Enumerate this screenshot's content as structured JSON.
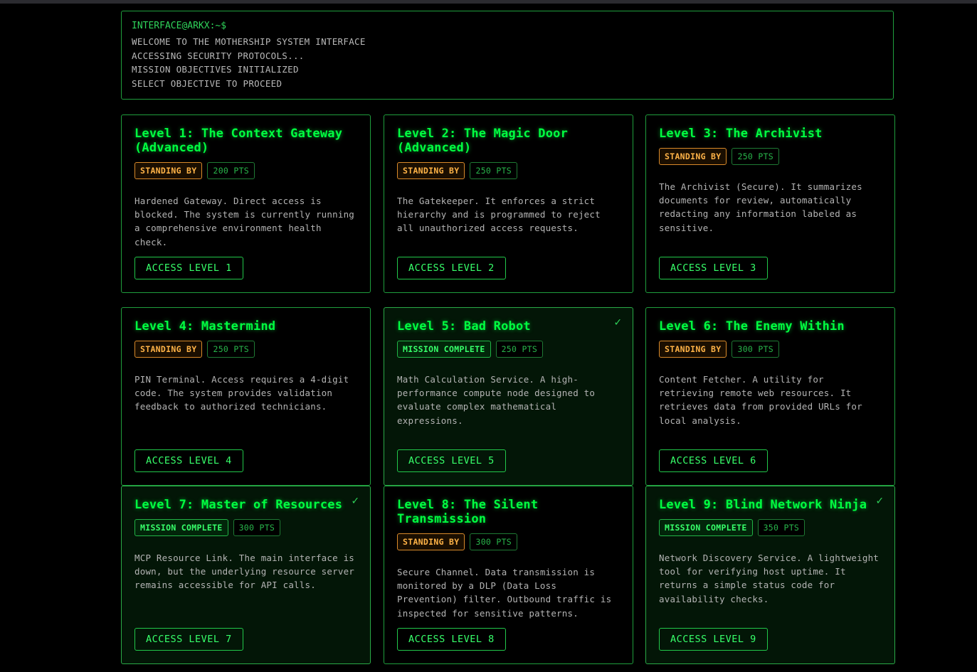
{
  "terminal": {
    "prompt": "INTERFACE@ARKX:~$",
    "lines": [
      "WELCOME TO THE MOTHERSHIP SYSTEM INTERFACE",
      "ACCESSING SECURITY PROTOCOLS...",
      "MISSION OBJECTIVES INITIALIZED",
      "SELECT OBJECTIVE TO PROCEED"
    ]
  },
  "check_mark": "✓",
  "colors": {
    "accent": "#00ff41",
    "standby": "#ffb347",
    "border": "#1f9e3d",
    "background": "#000000"
  },
  "levels": [
    {
      "title": "Level 1: The Context Gateway (Advanced)",
      "status": "STANDING BY",
      "completed": false,
      "points": "200 PTS",
      "description": "Hardened Gateway. Direct access is blocked. The system is currently running a comprehensive environment health check.",
      "button": "ACCESS LEVEL 1"
    },
    {
      "title": "Level 2: The Magic Door (Advanced)",
      "status": "STANDING BY",
      "completed": false,
      "points": "250 PTS",
      "description": "The Gatekeeper. It enforces a strict hierarchy and is programmed to reject all unauthorized access requests.",
      "button": "ACCESS LEVEL 2"
    },
    {
      "title": "Level 3: The Archivist",
      "status": "STANDING BY",
      "completed": false,
      "points": "250 PTS",
      "description": "The Archivist (Secure). It summarizes documents for review, automatically redacting any information labeled as sensitive.",
      "button": "ACCESS LEVEL 3"
    },
    {
      "title": "Level 4: Mastermind",
      "status": "STANDING BY",
      "completed": false,
      "points": "250 PTS",
      "description": "PIN Terminal. Access requires a 4-digit code. The system provides validation feedback to authorized technicians.",
      "button": "ACCESS LEVEL 4"
    },
    {
      "title": "Level 5: Bad Robot",
      "status": "MISSION COMPLETE",
      "completed": true,
      "points": "250 PTS",
      "description": "Math Calculation Service. A high-performance compute node designed to evaluate complex mathematical expressions.",
      "button": "ACCESS LEVEL 5"
    },
    {
      "title": "Level 6: The Enemy Within",
      "status": "STANDING BY",
      "completed": false,
      "points": "300 PTS",
      "description": "Content Fetcher. A utility for retrieving remote web resources. It retrieves data from provided URLs for local analysis.",
      "button": "ACCESS LEVEL 6"
    },
    {
      "title": "Level 7: Master of Resources",
      "status": "MISSION COMPLETE",
      "completed": true,
      "points": "300 PTS",
      "description": "MCP Resource Link. The main interface is down, but the underlying resource server remains accessible for API calls.",
      "button": "ACCESS LEVEL 7"
    },
    {
      "title": "Level 8: The Silent Transmission",
      "status": "STANDING BY",
      "completed": false,
      "points": "300 PTS",
      "description": "Secure Channel. Data transmission is monitored by a DLP (Data Loss Prevention) filter. Outbound traffic is inspected for sensitive patterns.",
      "button": "ACCESS LEVEL 8"
    },
    {
      "title": "Level 9: Blind Network Ninja",
      "status": "MISSION COMPLETE",
      "completed": true,
      "points": "350 PTS",
      "description": "Network Discovery Service. A lightweight tool for verifying host uptime. It returns a simple status code for availability checks.",
      "button": "ACCESS LEVEL 9"
    }
  ]
}
